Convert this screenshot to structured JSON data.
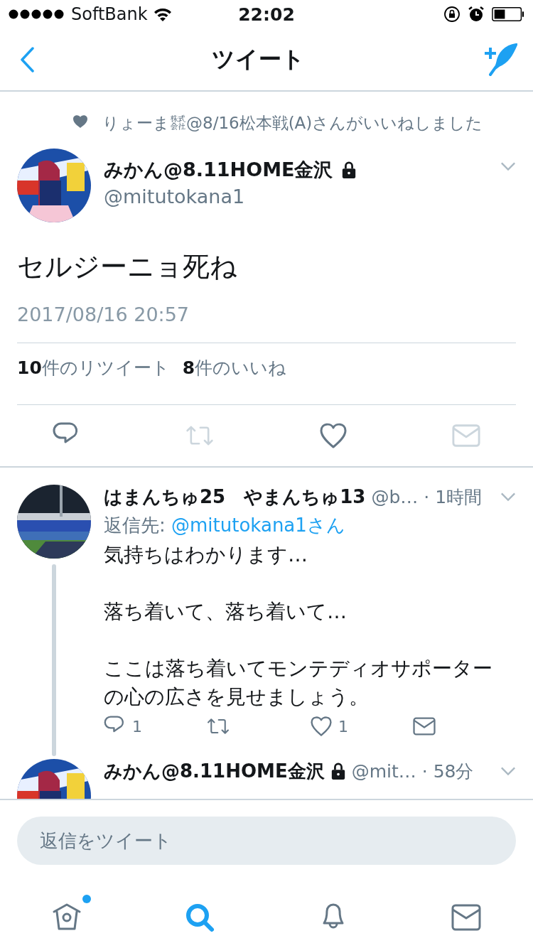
{
  "status_bar": {
    "carrier": "SoftBank",
    "time": "22:02"
  },
  "nav": {
    "title": "ツイート"
  },
  "tweet": {
    "liked_by": "りょーま㍿@8/16松本戦(A)さんがいいねしました",
    "author": {
      "name": "みかん@8.11HOME金沢",
      "handle": "@mitutokana1",
      "protected": true
    },
    "text": "セルジーニョ死ね",
    "timestamp": "2017/08/16 20:57",
    "stats": [
      {
        "count": "10",
        "label": "件のリツイート"
      },
      {
        "count": "8",
        "label": "件のいいね"
      }
    ],
    "actions": [
      {
        "kind": "reply",
        "disabled": false
      },
      {
        "kind": "retweet",
        "disabled": true
      },
      {
        "kind": "like",
        "disabled": false
      },
      {
        "kind": "message",
        "disabled": true
      }
    ]
  },
  "replies": [
    {
      "name": "はまんちゅ25　やまんちゅ13",
      "protected": false,
      "handle": "@b…",
      "time": "· 1時間",
      "reply_to_label": "返信先:",
      "reply_to": "@mitutokana1さん",
      "text": "気持ちはわかります…\n\n落ち着いて、落ち着いて…\n\nここは落ち着いてモンテディオサポーターの心の広さを見せましょう。",
      "thread": true,
      "actions": [
        {
          "kind": "reply",
          "count": "1"
        },
        {
          "kind": "retweet"
        },
        {
          "kind": "like",
          "count": "1"
        },
        {
          "kind": "message"
        }
      ]
    },
    {
      "name": "みかん@8.11HOME金沢",
      "protected": true,
      "handle": "@mit…",
      "time": "· 58分",
      "thread": false
    }
  ],
  "reply_box": {
    "placeholder": "返信をツイート"
  },
  "tabs": [
    {
      "kind": "home",
      "selected": false,
      "badge": true
    },
    {
      "kind": "search",
      "selected": true,
      "badge": false
    },
    {
      "kind": "notifications",
      "selected": false,
      "badge": false
    },
    {
      "kind": "messages",
      "selected": false,
      "badge": false
    }
  ]
}
